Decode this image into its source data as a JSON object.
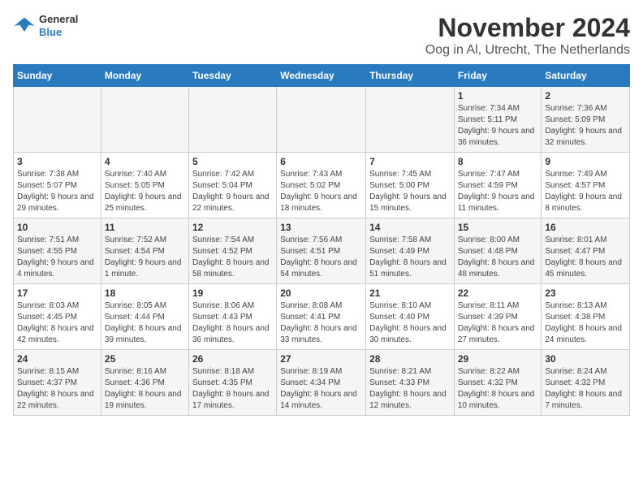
{
  "logo": {
    "general": "General",
    "blue": "Blue"
  },
  "title": "November 2024",
  "subtitle": "Oog in Al, Utrecht, The Netherlands",
  "headers": [
    "Sunday",
    "Monday",
    "Tuesday",
    "Wednesday",
    "Thursday",
    "Friday",
    "Saturday"
  ],
  "weeks": [
    [
      {
        "day": "",
        "info": ""
      },
      {
        "day": "",
        "info": ""
      },
      {
        "day": "",
        "info": ""
      },
      {
        "day": "",
        "info": ""
      },
      {
        "day": "",
        "info": ""
      },
      {
        "day": "1",
        "info": "Sunrise: 7:34 AM\nSunset: 5:11 PM\nDaylight: 9 hours and 36 minutes."
      },
      {
        "day": "2",
        "info": "Sunrise: 7:36 AM\nSunset: 5:09 PM\nDaylight: 9 hours and 32 minutes."
      }
    ],
    [
      {
        "day": "3",
        "info": "Sunrise: 7:38 AM\nSunset: 5:07 PM\nDaylight: 9 hours and 29 minutes."
      },
      {
        "day": "4",
        "info": "Sunrise: 7:40 AM\nSunset: 5:05 PM\nDaylight: 9 hours and 25 minutes."
      },
      {
        "day": "5",
        "info": "Sunrise: 7:42 AM\nSunset: 5:04 PM\nDaylight: 9 hours and 22 minutes."
      },
      {
        "day": "6",
        "info": "Sunrise: 7:43 AM\nSunset: 5:02 PM\nDaylight: 9 hours and 18 minutes."
      },
      {
        "day": "7",
        "info": "Sunrise: 7:45 AM\nSunset: 5:00 PM\nDaylight: 9 hours and 15 minutes."
      },
      {
        "day": "8",
        "info": "Sunrise: 7:47 AM\nSunset: 4:59 PM\nDaylight: 9 hours and 11 minutes."
      },
      {
        "day": "9",
        "info": "Sunrise: 7:49 AM\nSunset: 4:57 PM\nDaylight: 9 hours and 8 minutes."
      }
    ],
    [
      {
        "day": "10",
        "info": "Sunrise: 7:51 AM\nSunset: 4:55 PM\nDaylight: 9 hours and 4 minutes."
      },
      {
        "day": "11",
        "info": "Sunrise: 7:52 AM\nSunset: 4:54 PM\nDaylight: 9 hours and 1 minute."
      },
      {
        "day": "12",
        "info": "Sunrise: 7:54 AM\nSunset: 4:52 PM\nDaylight: 8 hours and 58 minutes."
      },
      {
        "day": "13",
        "info": "Sunrise: 7:56 AM\nSunset: 4:51 PM\nDaylight: 8 hours and 54 minutes."
      },
      {
        "day": "14",
        "info": "Sunrise: 7:58 AM\nSunset: 4:49 PM\nDaylight: 8 hours and 51 minutes."
      },
      {
        "day": "15",
        "info": "Sunrise: 8:00 AM\nSunset: 4:48 PM\nDaylight: 8 hours and 48 minutes."
      },
      {
        "day": "16",
        "info": "Sunrise: 8:01 AM\nSunset: 4:47 PM\nDaylight: 8 hours and 45 minutes."
      }
    ],
    [
      {
        "day": "17",
        "info": "Sunrise: 8:03 AM\nSunset: 4:45 PM\nDaylight: 8 hours and 42 minutes."
      },
      {
        "day": "18",
        "info": "Sunrise: 8:05 AM\nSunset: 4:44 PM\nDaylight: 8 hours and 39 minutes."
      },
      {
        "day": "19",
        "info": "Sunrise: 8:06 AM\nSunset: 4:43 PM\nDaylight: 8 hours and 36 minutes."
      },
      {
        "day": "20",
        "info": "Sunrise: 8:08 AM\nSunset: 4:41 PM\nDaylight: 8 hours and 33 minutes."
      },
      {
        "day": "21",
        "info": "Sunrise: 8:10 AM\nSunset: 4:40 PM\nDaylight: 8 hours and 30 minutes."
      },
      {
        "day": "22",
        "info": "Sunrise: 8:11 AM\nSunset: 4:39 PM\nDaylight: 8 hours and 27 minutes."
      },
      {
        "day": "23",
        "info": "Sunrise: 8:13 AM\nSunset: 4:38 PM\nDaylight: 8 hours and 24 minutes."
      }
    ],
    [
      {
        "day": "24",
        "info": "Sunrise: 8:15 AM\nSunset: 4:37 PM\nDaylight: 8 hours and 22 minutes."
      },
      {
        "day": "25",
        "info": "Sunrise: 8:16 AM\nSunset: 4:36 PM\nDaylight: 8 hours and 19 minutes."
      },
      {
        "day": "26",
        "info": "Sunrise: 8:18 AM\nSunset: 4:35 PM\nDaylight: 8 hours and 17 minutes."
      },
      {
        "day": "27",
        "info": "Sunrise: 8:19 AM\nSunset: 4:34 PM\nDaylight: 8 hours and 14 minutes."
      },
      {
        "day": "28",
        "info": "Sunrise: 8:21 AM\nSunset: 4:33 PM\nDaylight: 8 hours and 12 minutes."
      },
      {
        "day": "29",
        "info": "Sunrise: 8:22 AM\nSunset: 4:32 PM\nDaylight: 8 hours and 10 minutes."
      },
      {
        "day": "30",
        "info": "Sunrise: 8:24 AM\nSunset: 4:32 PM\nDaylight: 8 hours and 7 minutes."
      }
    ]
  ]
}
